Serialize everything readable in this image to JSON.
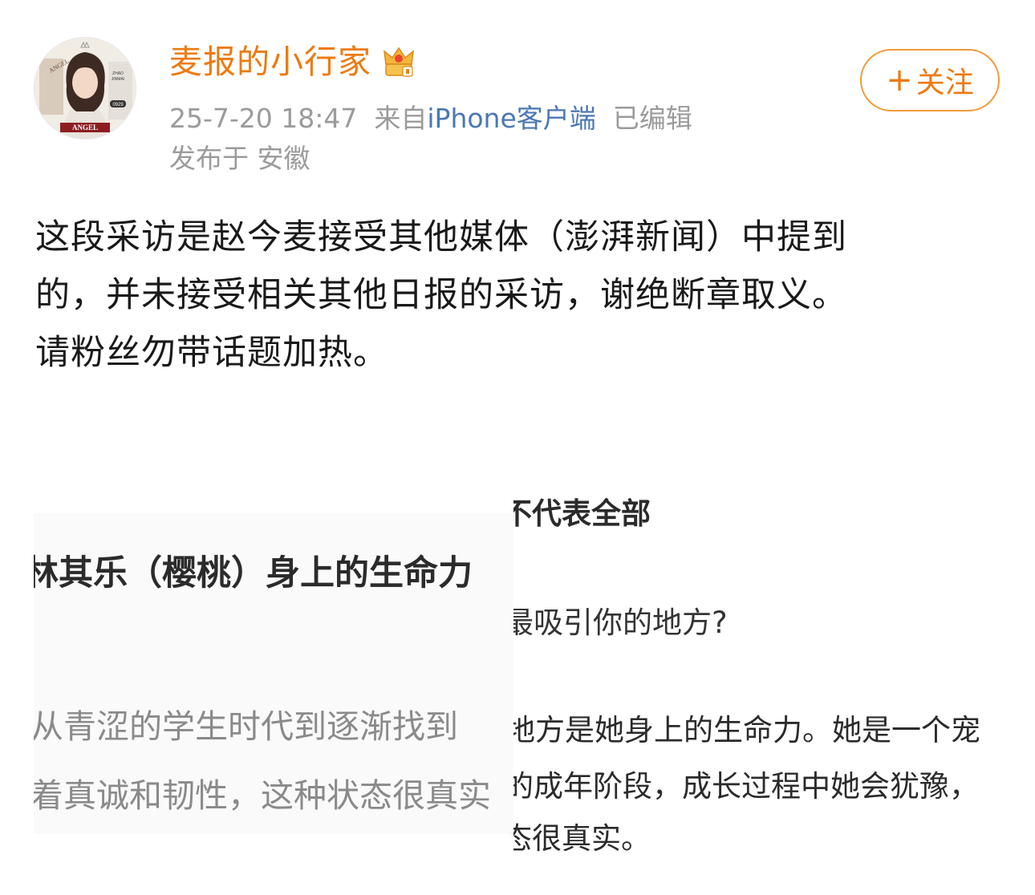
{
  "post": {
    "author": "麦报的小行家",
    "timestamp": "25-7-20 18:47",
    "source_prefix": "来自",
    "source": "iPhone客户端",
    "edited": "已编辑",
    "location": "发布于 安徽",
    "follow_plus": "+",
    "follow_label": "关注",
    "body": [
      "这段采访是赵今麦接受其他媒体（澎湃新闻）中提到",
      "的，并未接受相关其他日报的采访，谢绝断章取义。",
      "请粉丝勿带话题加热。"
    ]
  },
  "avatar": {
    "badge_top": "ANGEL",
    "badge_bottom": "ANGEL",
    "side_text_1": "ZHAO",
    "side_text_2": "JINMAI",
    "number": "0929"
  },
  "image_left": {
    "heading": "林其乐（樱桃）身上的生命力",
    "line1": "从青涩的学生时代到逐渐找到",
    "line2": "着真诚和韧性，这种状态很真实"
  },
  "image_right": {
    "heading": "不代表全部",
    "question": "最吸引你的地方?",
    "answer1": "地方是她身上的生命力。她是一个宠",
    "answer2": "的成年阶段，成长过程中她会犹豫，",
    "answer3": "态很真实。"
  },
  "colors": {
    "author": "#ec7b11",
    "source": "#4a78b3",
    "meta": "#9b9b9b",
    "follow_border": "#f19b39"
  }
}
